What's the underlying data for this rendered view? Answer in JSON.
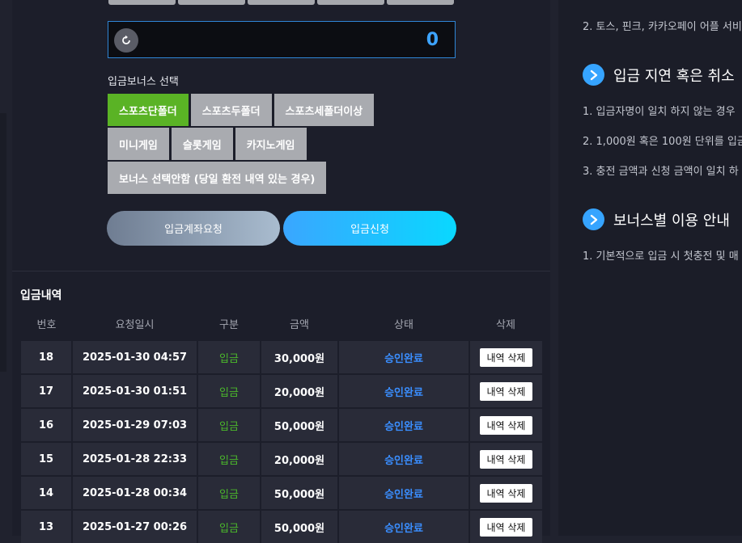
{
  "amount": {
    "value": "0",
    "reset_icon": "refresh-icon"
  },
  "bonus": {
    "title": "입금보너스 선택",
    "options_row1": [
      "스포츠단폴더",
      "스포츠두폴더",
      "스포츠세폴더이상"
    ],
    "options_row2": [
      "미니게임",
      "슬롯게임",
      "카지노게임"
    ],
    "options_row3": [
      "보너스 선택안함 (당일 환전 내역 있는 경우)"
    ],
    "selected": "스포츠단폴더"
  },
  "actions": {
    "account_request": "입금계좌요청",
    "deposit_request": "입금신청"
  },
  "history": {
    "title": "입금내역",
    "columns": [
      "번호",
      "요청일시",
      "구분",
      "금액",
      "상태",
      "삭제"
    ],
    "rows": [
      {
        "no": "18",
        "date": "2025-01-30 04:57",
        "type": "입금",
        "amount": "30,000원",
        "status": "승인완료",
        "delete": "내역 삭제"
      },
      {
        "no": "17",
        "date": "2025-01-30 01:51",
        "type": "입금",
        "amount": "20,000원",
        "status": "승인완료",
        "delete": "내역 삭제"
      },
      {
        "no": "16",
        "date": "2025-01-29 07:03",
        "type": "입금",
        "amount": "50,000원",
        "status": "승인완료",
        "delete": "내역 삭제"
      },
      {
        "no": "15",
        "date": "2025-01-28 22:33",
        "type": "입금",
        "amount": "20,000원",
        "status": "승인완료",
        "delete": "내역 삭제"
      },
      {
        "no": "14",
        "date": "2025-01-28 00:34",
        "type": "입금",
        "amount": "50,000원",
        "status": "승인완료",
        "delete": "내역 삭제"
      },
      {
        "no": "13",
        "date": "2025-01-27 00:26",
        "type": "입금",
        "amount": "50,000원",
        "status": "승인완료",
        "delete": "내역 삭제"
      }
    ]
  },
  "guide": {
    "line_top": "2. 토스, 핀크, 카카오페이 어플 서비",
    "section1_title": "입금 지연 혹은 취소",
    "section1_items": [
      "1. 입금자명이 일치 하지 않는 경우",
      "2. 1,000원 혹은 100원 단위를 입금",
      "3. 충전 금액과 신청 금액이 일치 하"
    ],
    "section2_title": "보너스별 이용 안내",
    "section2_items": [
      "1. 기본적으로 입금 시 첫충전 및 매"
    ]
  },
  "colors": {
    "accent_blue": "#3da3ff",
    "selected_green": "#5ab325",
    "status_blue": "#3a8eff",
    "type_green": "#4bb82b"
  }
}
